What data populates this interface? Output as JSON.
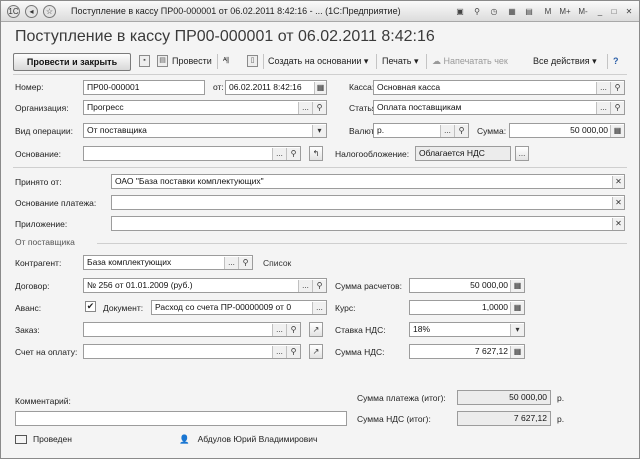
{
  "window": {
    "title": "Поступление в кассу ПР00-000001 от 06.02.2011 8:42:16 - ... (1С:Предприятие)",
    "controls": [
      "M",
      "M+",
      "M-"
    ]
  },
  "form_title": "Поступление в кассу ПР00-000001 от 06.02.2011 8:42:16",
  "toolbar": {
    "post_close": "Провести и закрыть",
    "post": "Провести",
    "create_basis": "Создать на основании",
    "print": "Печать",
    "print_receipt": "Напечатать чек",
    "all_actions": "Все действия"
  },
  "fields": {
    "number_label": "Номер:",
    "number_value": "ПР00-000001",
    "date_label": "от:",
    "date_value": "06.02.2011 8:42:16",
    "cashbox_label": "Касса:",
    "cashbox_value": "Основная касса",
    "org_label": "Организация:",
    "org_value": "Прогресс",
    "article_label": "Статья:",
    "article_value": "Оплата поставщикам",
    "operation_label": "Вид операции:",
    "operation_value": "От поставщика",
    "currency_label": "Валюта:",
    "currency_value": "р.",
    "sum_label": "Сумма:",
    "sum_value": "50 000,00",
    "basis_label": "Основание:",
    "basis_value": "",
    "tax_label": "Налогообложение:",
    "tax_value": "Облагается НДС",
    "received_from_label": "Принято от:",
    "received_from_value": "ОАО \"База поставки комплектующих\"",
    "payment_basis_label": "Основание платежа:",
    "payment_basis_value": "",
    "attachment_label": "Приложение:",
    "attachment_value": ""
  },
  "supplier_group": {
    "title": "От поставщика",
    "counterparty_label": "Контрагент:",
    "counterparty_value": "База комплектующих",
    "list_link": "Список",
    "contract_label": "Договор:",
    "contract_value": "№ 256 от 01.01.2009 (руб.)",
    "calc_sum_label": "Сумма расчетов:",
    "calc_sum_value": "50 000,00",
    "advance_label": "Аванс:",
    "advance_checked": true,
    "advance_check_mark": "✔",
    "document_label": "Документ:",
    "document_value": "Расход со счета ПР-00000009 от 0",
    "rate_label": "Курс:",
    "rate_value": "1,0000",
    "order_label": "Заказ:",
    "order_value": "",
    "vat_rate_label": "Ставка НДС:",
    "vat_rate_value": "18%",
    "invoice_label": "Счет на оплату:",
    "invoice_value": "",
    "vat_sum_label": "Сумма НДС:",
    "vat_sum_value": "7 627,12"
  },
  "footer": {
    "comment_label": "Комментарий:",
    "comment_value": "",
    "total_payment_label": "Сумма платежа (итог):",
    "total_payment_value": "50 000,00",
    "total_payment_unit": "р.",
    "total_vat_label": "Сумма НДС (итог):",
    "total_vat_value": "7 627,12",
    "total_vat_unit": "р.",
    "status": "Проведен",
    "author": "Абдулов Юрий Владимирович"
  }
}
